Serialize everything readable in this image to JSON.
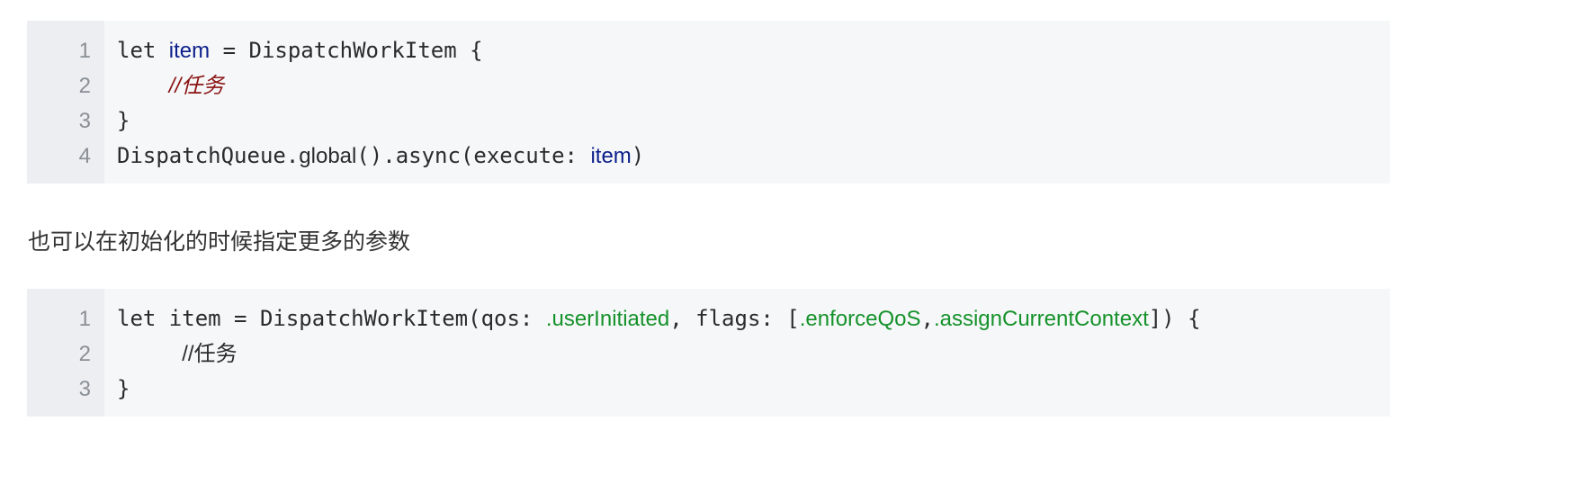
{
  "block1": {
    "line_numbers": [
      "1",
      "2",
      "3",
      "4"
    ],
    "line1": {
      "kw": "let ",
      "var": "item",
      "rest": " = DispatchWorkItem {"
    },
    "line2": {
      "indent": "    ",
      "comment": "//任务"
    },
    "line3": {
      "text": "}"
    },
    "line4": {
      "prefix": "DispatchQueue.",
      "global": "global",
      "mid": "().async(execute: ",
      "var": "item",
      "end": ")"
    }
  },
  "paragraph": {
    "text": "也可以在初始化的时候指定更多的参数"
  },
  "block2": {
    "line_numbers": [
      "1",
      "2",
      "3"
    ],
    "line1": {
      "prefix": "let item = DispatchWorkItem(qos: ",
      "qos": ".userInitiated",
      "mid": ", flags: [",
      "flag1": ".enforceQoS",
      "comma": ",",
      "flag2": ".assignCurrentContext",
      "end": "]) {"
    },
    "line2": {
      "indent": "     ",
      "comment": "//任务"
    },
    "line3": {
      "text": "}"
    }
  },
  "colors": {
    "code_background": "#f6f7f9",
    "gutter_background": "#eceef1",
    "variable": "#0b1f8a",
    "comment": "#8a1212",
    "enum_member": "#15922a"
  }
}
